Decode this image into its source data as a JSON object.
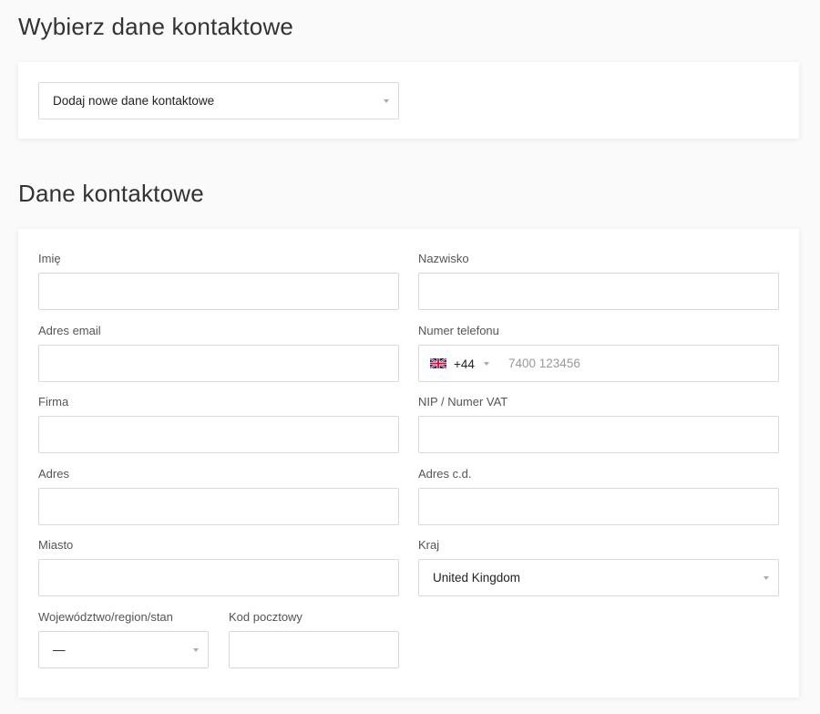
{
  "select_section": {
    "title": "Wybierz dane kontaktowe",
    "dropdown_value": "Dodaj nowe dane kontaktowe"
  },
  "contact_section": {
    "title": "Dane kontaktowe",
    "first_name": {
      "label": "Imię",
      "value": ""
    },
    "last_name": {
      "label": "Nazwisko",
      "value": ""
    },
    "email": {
      "label": "Adres email",
      "value": ""
    },
    "phone": {
      "label": "Numer telefonu",
      "country_code": "+44",
      "flag_icon": "uk-flag-icon",
      "placeholder": "7400 123456",
      "value": ""
    },
    "company": {
      "label": "Firma",
      "value": ""
    },
    "vat": {
      "label": "NIP / Numer VAT",
      "value": ""
    },
    "address": {
      "label": "Adres",
      "value": ""
    },
    "address2": {
      "label": "Adres c.d.",
      "value": ""
    },
    "city": {
      "label": "Miasto",
      "value": ""
    },
    "country": {
      "label": "Kraj",
      "value": "United Kingdom"
    },
    "region": {
      "label": "Województwo/region/stan",
      "value": "—"
    },
    "postcode": {
      "label": "Kod pocztowy",
      "value": ""
    }
  },
  "colors": {
    "background": "#fafafa",
    "card": "#ffffff",
    "border": "#d9d9d9",
    "label": "#555555",
    "placeholder": "#999999"
  }
}
